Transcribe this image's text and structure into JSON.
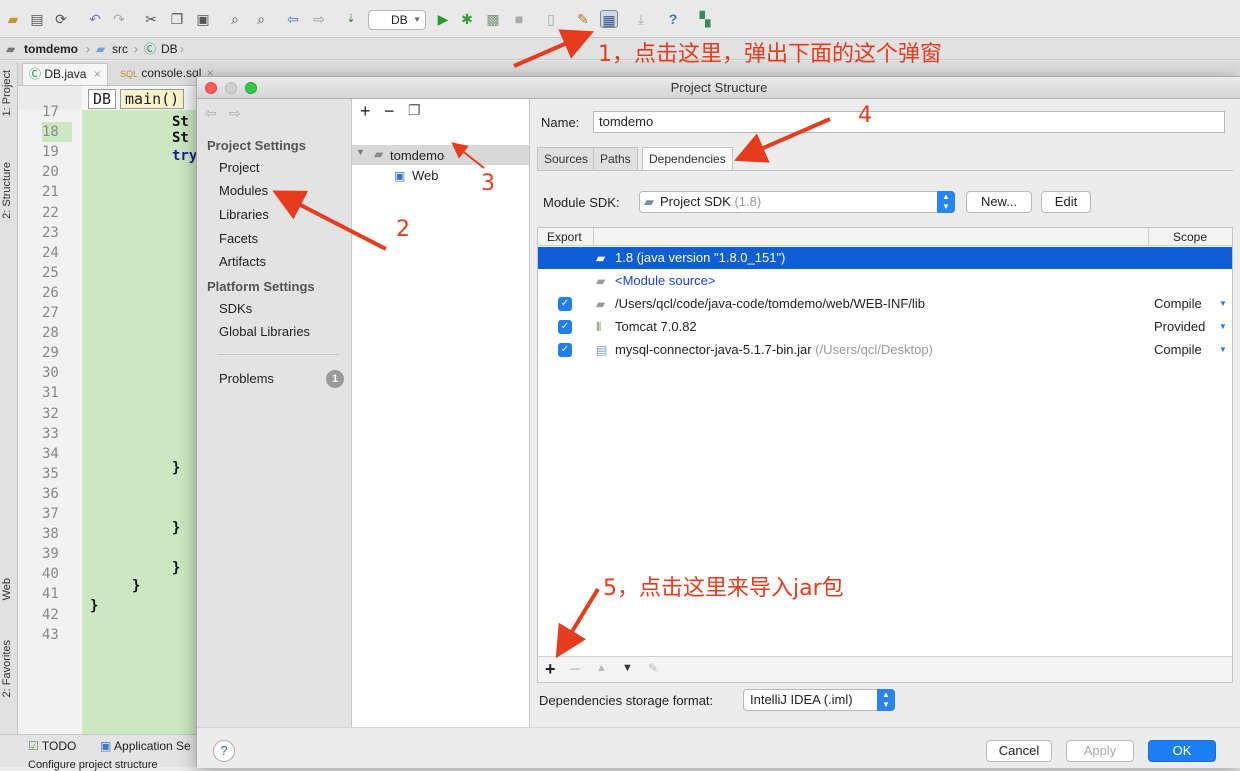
{
  "toolbar": {
    "run_config": "DB"
  },
  "breadcrumb": [
    "tomdemo",
    "src",
    "DB"
  ],
  "editor_tabs": [
    "DB.java",
    "console.sql"
  ],
  "side_tabs": {
    "project": "1: Project",
    "structure": "2: Structure",
    "web": "Web",
    "favorites": "2: Favorites"
  },
  "code_crumbs": [
    "DB",
    "main()"
  ],
  "line_numbers": [
    "17",
    "18",
    "19",
    "20",
    "21",
    "22",
    "23",
    "24",
    "25",
    "26",
    "27",
    "28",
    "29",
    "30",
    "31",
    "32",
    "33",
    "34",
    "35",
    "36",
    "37",
    "38",
    "39",
    "40",
    "41",
    "42",
    "43"
  ],
  "code_fragments": [
    "St",
    "St",
    "try",
    "}",
    "}",
    "}",
    "}",
    "}"
  ],
  "bottom_bar": {
    "todo": "TODO",
    "app_services": "Application Se",
    "status": "Configure project structure"
  },
  "dialog": {
    "title": "Project Structure",
    "nav": {
      "project_settings_heading": "Project Settings",
      "project_settings": [
        "Project",
        "Modules",
        "Libraries",
        "Facets",
        "Artifacts"
      ],
      "platform_settings_heading": "Platform Settings",
      "platform_settings": [
        "SDKs",
        "Global Libraries"
      ],
      "problems": "Problems",
      "problems_count": "1"
    },
    "tree": {
      "root": "tomdemo",
      "child": "Web"
    },
    "detail": {
      "name_label": "Name:",
      "name_value": "tomdemo",
      "tabs": [
        "Sources",
        "Paths",
        "Dependencies"
      ],
      "active_tab": "Dependencies",
      "module_sdk_label": "Module SDK:",
      "module_sdk_value": "Project SDK",
      "module_sdk_version": "(1.8)",
      "new_button": "New...",
      "edit_button": "Edit",
      "table_headers": {
        "export": "Export",
        "scope": "Scope"
      },
      "dependencies": [
        {
          "name": "1.8 (java version \"1.8.0_151\")",
          "suffix": "",
          "checked": false,
          "scope": "",
          "selected": true,
          "icon": "jdk-icon"
        },
        {
          "name": "<Module source>",
          "suffix": "",
          "checked": false,
          "scope": "",
          "selected": false,
          "icon": "folder-icon"
        },
        {
          "name": "/Users/qcl/code/java-code/tomdemo/web/WEB-INF/lib",
          "suffix": "",
          "checked": true,
          "scope": "Compile",
          "selected": false,
          "icon": "folder-icon"
        },
        {
          "name": "Tomcat 7.0.82",
          "suffix": "",
          "checked": true,
          "scope": "Provided",
          "selected": false,
          "icon": "library-icon"
        },
        {
          "name": "mysql-connector-java-5.1.7-bin.jar",
          "suffix": "(/Users/qcl/Desktop)",
          "checked": true,
          "scope": "Compile",
          "selected": false,
          "icon": "jar-icon"
        }
      ],
      "storage_format_label": "Dependencies storage format:",
      "storage_format_value": "IntelliJ IDEA (.iml)"
    },
    "footer": {
      "help": "?",
      "cancel": "Cancel",
      "apply": "Apply",
      "ok": "OK"
    }
  },
  "annotations": {
    "note1": "1，点击这里，弹出下面的这个弹窗",
    "note2": "2",
    "note3": "3",
    "note4": "4",
    "note5": "5，点击这里来导入jar包"
  },
  "colors": {
    "annotation": "#e63c1e",
    "selection": "#0f5ed6",
    "ok_button": "#1a7ff5",
    "link_blue": "#1a3fd6",
    "code_highlight": "#cbe8c2"
  }
}
